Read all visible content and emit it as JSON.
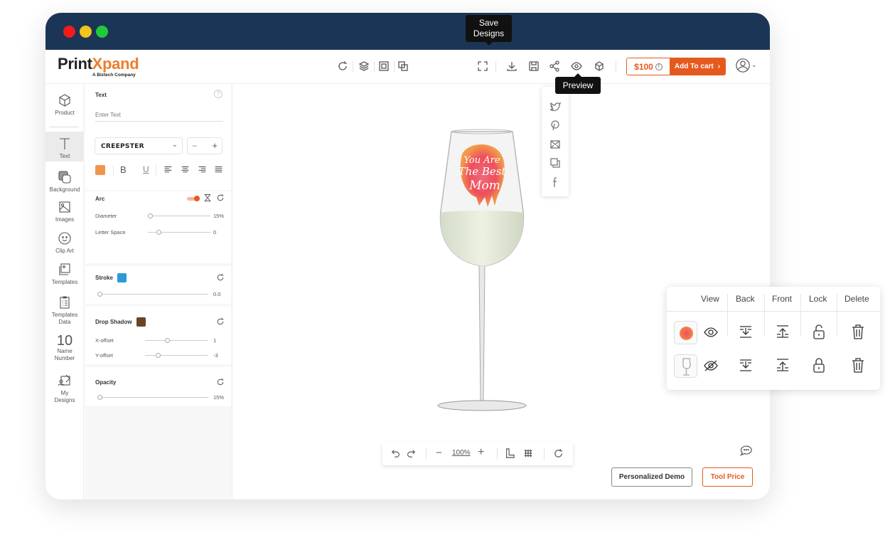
{
  "window": {
    "controls": [
      "close",
      "minimize",
      "maximize"
    ]
  },
  "header": {
    "logo_part1": "Print",
    "logo_part2": "Xpand",
    "logo_tagline": "A Biztech Company",
    "left_tools": [
      "refresh-icon",
      "layers-icon",
      "group-icon",
      "ungroup-icon"
    ],
    "right_tools": [
      "fullscreen-icon",
      "download-icon",
      "save-icon",
      "share-icon",
      "preview-icon",
      "3d-icon"
    ],
    "price": "$100",
    "add_to_cart": "Add To cart",
    "tooltip_save": "Save Designs",
    "tooltip_preview": "Preview"
  },
  "share_menu": [
    "twitter",
    "pinterest",
    "email",
    "copy",
    "facebook"
  ],
  "nav": {
    "items": [
      {
        "label": "Product",
        "icon": "cube-icon"
      },
      {
        "label": "Text",
        "icon": "text-icon",
        "active": true
      },
      {
        "label": "Background",
        "icon": "background-icon"
      },
      {
        "label": "Images",
        "icon": "image-icon"
      },
      {
        "label": "Clip Art",
        "icon": "smiley-icon"
      },
      {
        "label": "Templates",
        "icon": "templates-icon"
      },
      {
        "label": "Templates Data",
        "icon": "clipboard-icon"
      },
      {
        "label": "Name Number",
        "icon": "number-icon",
        "glyph": "10"
      },
      {
        "label": "My Designs",
        "icon": "my-designs-icon"
      }
    ]
  },
  "panel": {
    "text": {
      "title": "Text",
      "placeholder": "Enter Text",
      "font": "CREEPSTER",
      "minus": "−",
      "plus": "+",
      "color": "#f0964a",
      "bold": "B",
      "underline": "U"
    },
    "arc": {
      "title": "Arc",
      "enabled": true,
      "diameter_label": "Diameter",
      "diameter_value": "15%",
      "diameter_frac": 0.0,
      "letter_space_label": "Letter Space",
      "letter_space_value": "0",
      "letter_space_frac": 0.15
    },
    "stroke": {
      "title": "Stroke",
      "color": "#2a9ad8",
      "value": "0.0",
      "frac": 0.0
    },
    "shadow": {
      "title": "Drop Shadow",
      "color": "#6b4424",
      "x_label": "X-offset",
      "x_value": "1",
      "x_frac": 0.35,
      "y_label": "Y-offset",
      "y_value": "-3",
      "y_frac": 0.18
    },
    "opacity": {
      "title": "Opacity",
      "value": "15%",
      "frac": 0.0
    }
  },
  "canvas": {
    "design_text": [
      "You Are",
      "The Best",
      "Mom"
    ],
    "zoom": "100%"
  },
  "layers": {
    "headers": [
      "View",
      "Back",
      "Front",
      "Lock",
      "Delete"
    ],
    "rows": [
      {
        "name": "design-layer",
        "visible": true,
        "locked": false
      },
      {
        "name": "product-layer",
        "visible": false,
        "locked": true
      }
    ]
  },
  "footer": {
    "demo": "Personalized Demo",
    "tool_price": "Tool Price"
  },
  "colors": {
    "accent": "#e5591f",
    "titlebar": "#1b3556"
  }
}
